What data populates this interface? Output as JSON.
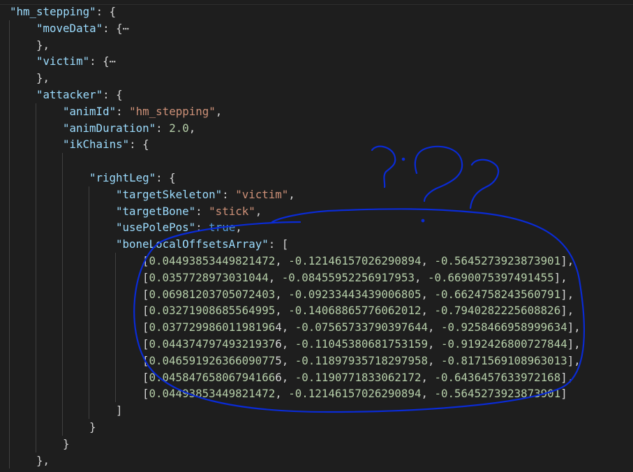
{
  "lines": [
    {
      "tokens": [
        {
          "t": "\"hm_stepping\"",
          "c": "k"
        },
        {
          "t": ": {",
          "c": "p"
        }
      ]
    },
    {
      "tokens": [
        {
          "t": "\"moveData\"",
          "c": "k"
        },
        {
          "t": ": {",
          "c": "p"
        },
        {
          "t": "⋯",
          "c": "fold"
        }
      ]
    },
    {
      "tokens": [
        {
          "t": "},",
          "c": "p"
        }
      ]
    },
    {
      "tokens": [
        {
          "t": "\"victim\"",
          "c": "k"
        },
        {
          "t": ": {",
          "c": "p"
        },
        {
          "t": "⋯",
          "c": "fold"
        }
      ]
    },
    {
      "tokens": [
        {
          "t": "},",
          "c": "p"
        }
      ]
    },
    {
      "tokens": [
        {
          "t": "\"attacker\"",
          "c": "k"
        },
        {
          "t": ": {",
          "c": "p"
        }
      ]
    },
    {
      "tokens": [
        {
          "t": "\"animId\"",
          "c": "k"
        },
        {
          "t": ": ",
          "c": "p"
        },
        {
          "t": "\"hm_stepping\"",
          "c": "s"
        },
        {
          "t": ",",
          "c": "p"
        }
      ]
    },
    {
      "tokens": [
        {
          "t": "\"animDuration\"",
          "c": "k"
        },
        {
          "t": ": ",
          "c": "p"
        },
        {
          "t": "2.0",
          "c": "n"
        },
        {
          "t": ",",
          "c": "p"
        }
      ]
    },
    {
      "tokens": [
        {
          "t": "\"ikChains\"",
          "c": "k"
        },
        {
          "t": ": {",
          "c": "p"
        }
      ]
    },
    {
      "tokens": []
    },
    {
      "tokens": [
        {
          "t": "\"rightLeg\"",
          "c": "k"
        },
        {
          "t": ": {",
          "c": "p"
        }
      ]
    },
    {
      "tokens": [
        {
          "t": "\"targetSkeleton\"",
          "c": "k"
        },
        {
          "t": ": ",
          "c": "p"
        },
        {
          "t": "\"victim\"",
          "c": "s"
        },
        {
          "t": ",",
          "c": "p"
        }
      ]
    },
    {
      "tokens": [
        {
          "t": "\"targetBone\"",
          "c": "k"
        },
        {
          "t": ": ",
          "c": "p"
        },
        {
          "t": "\"stick\"",
          "c": "s"
        },
        {
          "t": ",",
          "c": "p"
        }
      ]
    },
    {
      "tokens": [
        {
          "t": "\"usePolePos\"",
          "c": "k"
        },
        {
          "t": ": ",
          "c": "p"
        },
        {
          "t": "true",
          "c": "b"
        },
        {
          "t": ",",
          "c": "p"
        }
      ]
    },
    {
      "tokens": [
        {
          "t": "\"boneLocalOffsetsArray\"",
          "c": "k"
        },
        {
          "t": ": [",
          "c": "p"
        }
      ]
    },
    {
      "tokens": [
        {
          "t": "[",
          "c": "p"
        },
        {
          "t": "0.04493853449821472",
          "c": "n"
        },
        {
          "t": ", ",
          "c": "p"
        },
        {
          "t": "-0.12146157026290894",
          "c": "n"
        },
        {
          "t": ", ",
          "c": "p"
        },
        {
          "t": "-0.5645273923873901",
          "c": "n"
        },
        {
          "t": "],",
          "c": "p"
        }
      ]
    },
    {
      "tokens": [
        {
          "t": "[",
          "c": "p"
        },
        {
          "t": "0.0357728973031044",
          "c": "n"
        },
        {
          "t": ", ",
          "c": "p"
        },
        {
          "t": "-0.08455952256917953",
          "c": "n"
        },
        {
          "t": ", ",
          "c": "p"
        },
        {
          "t": "-0.6690075397491455",
          "c": "n"
        },
        {
          "t": "],",
          "c": "p"
        }
      ]
    },
    {
      "tokens": [
        {
          "t": "[",
          "c": "p"
        },
        {
          "t": "0.06981203705072403",
          "c": "n"
        },
        {
          "t": ", ",
          "c": "p"
        },
        {
          "t": "-0.09233443439006805",
          "c": "n"
        },
        {
          "t": ", ",
          "c": "p"
        },
        {
          "t": "-0.6624758243560791",
          "c": "n"
        },
        {
          "t": "],",
          "c": "p"
        }
      ]
    },
    {
      "tokens": [
        {
          "t": "[",
          "c": "p"
        },
        {
          "t": "0.03271908685564995",
          "c": "n"
        },
        {
          "t": ", ",
          "c": "p"
        },
        {
          "t": "-0.14068865776062012",
          "c": "n"
        },
        {
          "t": ", ",
          "c": "p"
        },
        {
          "t": "-0.7940282225608826",
          "c": "n"
        },
        {
          "t": "],",
          "c": "p"
        }
      ]
    },
    {
      "tokens": [
        {
          "t": "[",
          "c": "p"
        },
        {
          "t": "0.03772998601198196",
          "c": "n"
        },
        {
          "t": "4, ",
          "c": "p"
        },
        {
          "t": "-0.07565733790397644",
          "c": "n"
        },
        {
          "t": ", ",
          "c": "p"
        },
        {
          "t": "-0.9258466958999634",
          "c": "n"
        },
        {
          "t": "],",
          "c": "p"
        }
      ]
    },
    {
      "tokens": [
        {
          "t": "[",
          "c": "p"
        },
        {
          "t": "0.04437479749321937",
          "c": "n"
        },
        {
          "t": "6, ",
          "c": "p"
        },
        {
          "t": "-0.11045380681753159",
          "c": "n"
        },
        {
          "t": ", ",
          "c": "p"
        },
        {
          "t": "-0.9192426800727844",
          "c": "n"
        },
        {
          "t": "],",
          "c": "p"
        }
      ]
    },
    {
      "tokens": [
        {
          "t": "[",
          "c": "p"
        },
        {
          "t": "0.04659192636609077",
          "c": "n"
        },
        {
          "t": "5, ",
          "c": "p"
        },
        {
          "t": "-0.11897935718297958",
          "c": "n"
        },
        {
          "t": ", ",
          "c": "p"
        },
        {
          "t": "-0.8171569108963013",
          "c": "n"
        },
        {
          "t": "],",
          "c": "p"
        }
      ]
    },
    {
      "tokens": [
        {
          "t": "[",
          "c": "p"
        },
        {
          "t": "0.04584765806794166",
          "c": "n"
        },
        {
          "t": "6, ",
          "c": "p"
        },
        {
          "t": "-0.1190771833062172",
          "c": "n"
        },
        {
          "t": ", ",
          "c": "p"
        },
        {
          "t": "-0.6436457633972168",
          "c": "n"
        },
        {
          "t": "],",
          "c": "p"
        }
      ]
    },
    {
      "tokens": [
        {
          "t": "[",
          "c": "p"
        },
        {
          "t": "0.04493853449821472",
          "c": "n"
        },
        {
          "t": ", ",
          "c": "p"
        },
        {
          "t": "-0.12146157026290894",
          "c": "n"
        },
        {
          "t": ", ",
          "c": "p"
        },
        {
          "t": "-0.5645273923873901",
          "c": "n"
        },
        {
          "t": "]",
          "c": "p"
        }
      ]
    },
    {
      "tokens": [
        {
          "t": "]",
          "c": "p"
        }
      ]
    },
    {
      "tokens": [
        {
          "t": "}",
          "c": "p"
        }
      ]
    },
    {
      "tokens": [
        {
          "t": "}",
          "c": "p"
        }
      ]
    },
    {
      "tokens": [
        {
          "t": "},",
          "c": "p"
        }
      ]
    }
  ],
  "annotation": {
    "text": "???",
    "color": "#0a2bd6"
  }
}
